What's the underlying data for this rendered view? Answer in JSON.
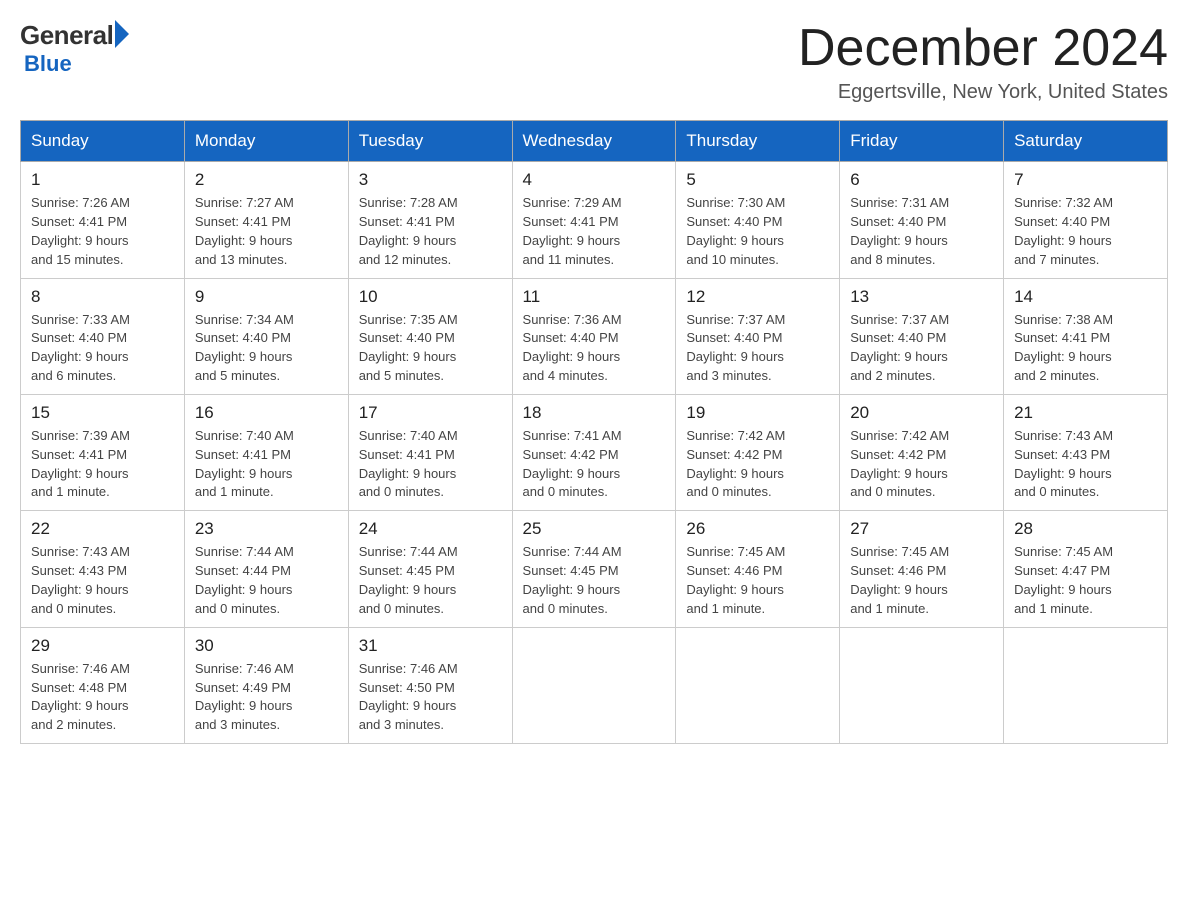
{
  "logo": {
    "general": "General",
    "blue": "Blue"
  },
  "title": {
    "month": "December 2024",
    "location": "Eggertsville, New York, United States"
  },
  "days_of_week": [
    "Sunday",
    "Monday",
    "Tuesday",
    "Wednesday",
    "Thursday",
    "Friday",
    "Saturday"
  ],
  "weeks": [
    [
      {
        "day": "1",
        "sunrise": "7:26 AM",
        "sunset": "4:41 PM",
        "daylight": "9 hours and 15 minutes."
      },
      {
        "day": "2",
        "sunrise": "7:27 AM",
        "sunset": "4:41 PM",
        "daylight": "9 hours and 13 minutes."
      },
      {
        "day": "3",
        "sunrise": "7:28 AM",
        "sunset": "4:41 PM",
        "daylight": "9 hours and 12 minutes."
      },
      {
        "day": "4",
        "sunrise": "7:29 AM",
        "sunset": "4:41 PM",
        "daylight": "9 hours and 11 minutes."
      },
      {
        "day": "5",
        "sunrise": "7:30 AM",
        "sunset": "4:40 PM",
        "daylight": "9 hours and 10 minutes."
      },
      {
        "day": "6",
        "sunrise": "7:31 AM",
        "sunset": "4:40 PM",
        "daylight": "9 hours and 8 minutes."
      },
      {
        "day": "7",
        "sunrise": "7:32 AM",
        "sunset": "4:40 PM",
        "daylight": "9 hours and 7 minutes."
      }
    ],
    [
      {
        "day": "8",
        "sunrise": "7:33 AM",
        "sunset": "4:40 PM",
        "daylight": "9 hours and 6 minutes."
      },
      {
        "day": "9",
        "sunrise": "7:34 AM",
        "sunset": "4:40 PM",
        "daylight": "9 hours and 5 minutes."
      },
      {
        "day": "10",
        "sunrise": "7:35 AM",
        "sunset": "4:40 PM",
        "daylight": "9 hours and 5 minutes."
      },
      {
        "day": "11",
        "sunrise": "7:36 AM",
        "sunset": "4:40 PM",
        "daylight": "9 hours and 4 minutes."
      },
      {
        "day": "12",
        "sunrise": "7:37 AM",
        "sunset": "4:40 PM",
        "daylight": "9 hours and 3 minutes."
      },
      {
        "day": "13",
        "sunrise": "7:37 AM",
        "sunset": "4:40 PM",
        "daylight": "9 hours and 2 minutes."
      },
      {
        "day": "14",
        "sunrise": "7:38 AM",
        "sunset": "4:41 PM",
        "daylight": "9 hours and 2 minutes."
      }
    ],
    [
      {
        "day": "15",
        "sunrise": "7:39 AM",
        "sunset": "4:41 PM",
        "daylight": "9 hours and 1 minute."
      },
      {
        "day": "16",
        "sunrise": "7:40 AM",
        "sunset": "4:41 PM",
        "daylight": "9 hours and 1 minute."
      },
      {
        "day": "17",
        "sunrise": "7:40 AM",
        "sunset": "4:41 PM",
        "daylight": "9 hours and 0 minutes."
      },
      {
        "day": "18",
        "sunrise": "7:41 AM",
        "sunset": "4:42 PM",
        "daylight": "9 hours and 0 minutes."
      },
      {
        "day": "19",
        "sunrise": "7:42 AM",
        "sunset": "4:42 PM",
        "daylight": "9 hours and 0 minutes."
      },
      {
        "day": "20",
        "sunrise": "7:42 AM",
        "sunset": "4:42 PM",
        "daylight": "9 hours and 0 minutes."
      },
      {
        "day": "21",
        "sunrise": "7:43 AM",
        "sunset": "4:43 PM",
        "daylight": "9 hours and 0 minutes."
      }
    ],
    [
      {
        "day": "22",
        "sunrise": "7:43 AM",
        "sunset": "4:43 PM",
        "daylight": "9 hours and 0 minutes."
      },
      {
        "day": "23",
        "sunrise": "7:44 AM",
        "sunset": "4:44 PM",
        "daylight": "9 hours and 0 minutes."
      },
      {
        "day": "24",
        "sunrise": "7:44 AM",
        "sunset": "4:45 PM",
        "daylight": "9 hours and 0 minutes."
      },
      {
        "day": "25",
        "sunrise": "7:44 AM",
        "sunset": "4:45 PM",
        "daylight": "9 hours and 0 minutes."
      },
      {
        "day": "26",
        "sunrise": "7:45 AM",
        "sunset": "4:46 PM",
        "daylight": "9 hours and 1 minute."
      },
      {
        "day": "27",
        "sunrise": "7:45 AM",
        "sunset": "4:46 PM",
        "daylight": "9 hours and 1 minute."
      },
      {
        "day": "28",
        "sunrise": "7:45 AM",
        "sunset": "4:47 PM",
        "daylight": "9 hours and 1 minute."
      }
    ],
    [
      {
        "day": "29",
        "sunrise": "7:46 AM",
        "sunset": "4:48 PM",
        "daylight": "9 hours and 2 minutes."
      },
      {
        "day": "30",
        "sunrise": "7:46 AM",
        "sunset": "4:49 PM",
        "daylight": "9 hours and 3 minutes."
      },
      {
        "day": "31",
        "sunrise": "7:46 AM",
        "sunset": "4:50 PM",
        "daylight": "9 hours and 3 minutes."
      },
      null,
      null,
      null,
      null
    ]
  ],
  "labels": {
    "sunrise": "Sunrise:",
    "sunset": "Sunset:",
    "daylight": "Daylight:"
  }
}
